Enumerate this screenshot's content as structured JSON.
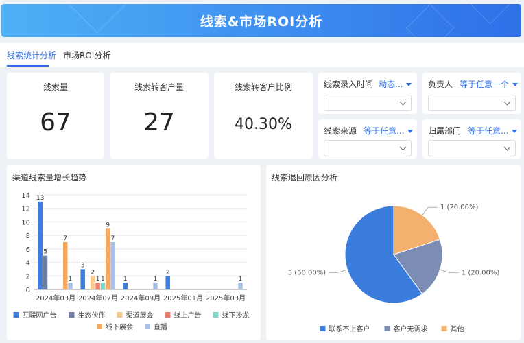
{
  "header": {
    "title": "线索&市场ROI分析"
  },
  "tabs": [
    {
      "label": "线索统计分析",
      "active": true
    },
    {
      "label": "市场ROI分析",
      "active": false
    }
  ],
  "kpis": [
    {
      "label": "线索量",
      "value": "67"
    },
    {
      "label": "线索转客户量",
      "value": "27"
    },
    {
      "label": "线索转客户比例",
      "value": "40.30%"
    }
  ],
  "filters": [
    {
      "label": "线索录入时间",
      "operator": "动态..."
    },
    {
      "label": "负责人",
      "operator": "等于任意一个"
    },
    {
      "label": "线索来源",
      "operator": "等于任意..."
    },
    {
      "label": "归属部门",
      "operator": "等于任意..."
    }
  ],
  "colors": {
    "accent": "#2f6fe8",
    "series": [
      "#3b7ddd",
      "#6e7fa8",
      "#f7c98c",
      "#f07d6b",
      "#7dd6c8",
      "#f4a860",
      "#a9c0e6"
    ],
    "pie": [
      "#3b7ddd",
      "#7b8db5",
      "#f4b06e"
    ]
  },
  "charts": {
    "bar_title": "渠道线索量增长趋势",
    "pie_title": "线索退回原因分析"
  },
  "chart_data": [
    {
      "type": "bar",
      "categories": [
        "2024年03月",
        "2024年07月",
        "2024年09月",
        "2025年01月",
        "2025年03月"
      ],
      "ylim": [
        0,
        14
      ],
      "yticks": [
        0,
        2,
        4,
        6,
        8,
        10,
        12,
        14
      ],
      "grid": true,
      "legend_position": "bottom",
      "series": [
        {
          "name": "互联网广告",
          "values": [
            13,
            3,
            1,
            2,
            0
          ]
        },
        {
          "name": "生态伙伴",
          "values": [
            5,
            0,
            0,
            0,
            0
          ]
        },
        {
          "name": "渠道展会",
          "values": [
            0,
            2,
            0,
            0,
            0
          ]
        },
        {
          "name": "线上广告",
          "values": [
            0,
            1,
            0,
            0,
            0
          ]
        },
        {
          "name": "线下沙龙",
          "values": [
            0,
            1,
            0,
            0,
            0
          ]
        },
        {
          "name": "线下展会",
          "values": [
            7,
            9,
            0,
            0,
            0
          ]
        },
        {
          "name": "直播",
          "values": [
            1,
            7,
            1,
            0,
            1
          ]
        }
      ]
    },
    {
      "type": "pie",
      "legend_position": "bottom",
      "slices": [
        {
          "name": "联系不上客户",
          "value": 3,
          "label": "3 (60.00%)"
        },
        {
          "name": "客户无需求",
          "value": 1,
          "label": "1 (20.00%)"
        },
        {
          "name": "其他",
          "value": 1,
          "label": "1 (20.00%)"
        }
      ]
    }
  ]
}
